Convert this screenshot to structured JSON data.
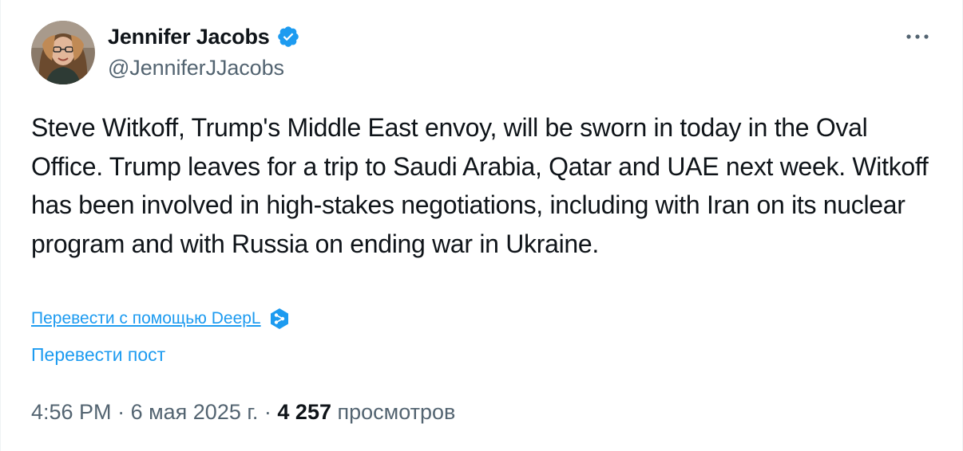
{
  "author": {
    "display_name": "Jennifer Jacobs",
    "handle": "@JenniferJJacobs",
    "verified": true
  },
  "tweet": {
    "text": "Steve Witkoff, Trump's Middle East envoy, will be sworn in today in the Oval Office. Trump leaves for a trip to Saudi Arabia, Qatar and UAE next week. Witkoff has been involved in high-stakes negotiations, including with Iran on its nuclear program and with Russia on ending war in Ukraine."
  },
  "translate": {
    "deepl_label": "Перевести с помощью DeepL",
    "post_label": "Перевести пост"
  },
  "meta": {
    "time": "4:56 PM",
    "separator": " · ",
    "date": "6 мая 2025 г.",
    "views_count": "4 257",
    "views_label": " просмотров"
  },
  "colors": {
    "accent": "#1d9bf0",
    "text_primary": "#0f1419",
    "text_secondary": "#536471",
    "deepl_brand": "#0f2b46"
  },
  "icons": {
    "verified": "verified-badge-icon",
    "more": "more-horizontal-icon",
    "deepl": "deepl-logo-icon"
  }
}
